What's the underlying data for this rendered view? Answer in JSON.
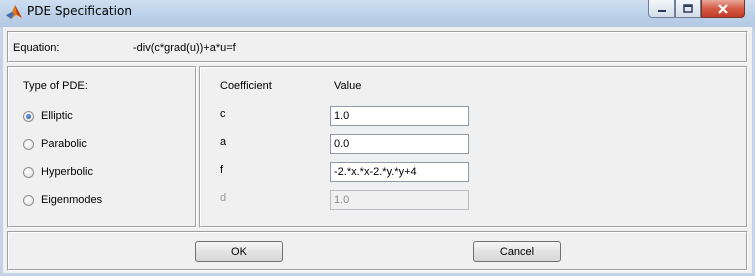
{
  "window": {
    "title": "PDE Specification",
    "min_icon": "minimize-icon",
    "max_icon": "maximize-icon",
    "close_icon": "close-icon",
    "app_icon": "matlab-icon"
  },
  "equation": {
    "label": "Equation:",
    "value": "-div(c*grad(u))+a*u=f"
  },
  "pde_type": {
    "heading": "Type of PDE:",
    "options": [
      {
        "label": "Elliptic",
        "checked": true
      },
      {
        "label": "Parabolic",
        "checked": false
      },
      {
        "label": "Hyperbolic",
        "checked": false
      },
      {
        "label": "Eigenmodes",
        "checked": false
      }
    ]
  },
  "coefficients": {
    "col_coefficient": "Coefficient",
    "col_value": "Value",
    "rows": [
      {
        "name": "c",
        "value": "1.0",
        "enabled": true
      },
      {
        "name": "a",
        "value": "0.0",
        "enabled": true
      },
      {
        "name": "f",
        "value": "-2.*x.*x-2.*y.*y+4",
        "enabled": true
      },
      {
        "name": "d",
        "value": "1.0",
        "enabled": false
      }
    ]
  },
  "buttons": {
    "ok": "OK",
    "cancel": "Cancel"
  }
}
